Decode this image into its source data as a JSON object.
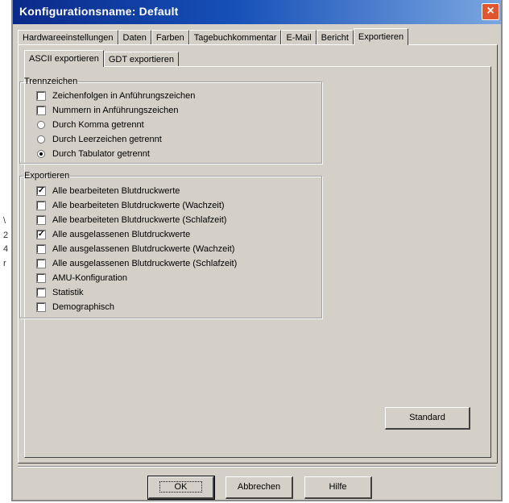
{
  "window": {
    "title": "Konfigurationsname: Default",
    "close_label": "×"
  },
  "outer_tabs": [
    {
      "label": "Hardwareeinstellungen",
      "active": false
    },
    {
      "label": "Daten",
      "active": false
    },
    {
      "label": "Farben",
      "active": false
    },
    {
      "label": "Tagebuchkommentar",
      "active": false
    },
    {
      "label": "E-Mail",
      "active": false
    },
    {
      "label": "Bericht",
      "active": false
    },
    {
      "label": "Exportieren",
      "active": true
    }
  ],
  "inner_tabs": [
    {
      "label": "ASCII exportieren",
      "active": true
    },
    {
      "label": "GDT exportieren",
      "active": false
    }
  ],
  "trennzeichen": {
    "legend": "Trennzeichen",
    "options": [
      {
        "type": "checkbox",
        "label": "Zeichenfolgen in Anführungszeichen",
        "checked": false
      },
      {
        "type": "checkbox",
        "label": "Nummern in Anführungszeichen",
        "checked": false
      },
      {
        "type": "radio",
        "label": "Durch Komma getrennt",
        "checked": false
      },
      {
        "type": "radio",
        "label": "Durch Leerzeichen getrennt",
        "checked": false
      },
      {
        "type": "radio",
        "label": "Durch Tabulator getrennt",
        "checked": true
      }
    ]
  },
  "exportieren": {
    "legend": "Exportieren",
    "options": [
      {
        "label": "Alle bearbeiteten Blutdruckwerte",
        "checked": true
      },
      {
        "label": "Alle bearbeiteten Blutdruckwerte (Wachzeit)",
        "checked": false
      },
      {
        "label": "Alle bearbeiteten Blutdruckwerte (Schlafzeit)",
        "checked": false
      },
      {
        "label": "Alle ausgelassenen Blutdruckwerte",
        "checked": true
      },
      {
        "label": "Alle ausgelassenen Blutdruckwerte (Wachzeit)",
        "checked": false
      },
      {
        "label": "Alle ausgelassenen Blutdruckwerte (Schlafzeit)",
        "checked": false
      },
      {
        "label": "AMU-Konfiguration",
        "checked": false
      },
      {
        "label": "Statistik",
        "checked": false
      },
      {
        "label": "Demographisch",
        "checked": false
      }
    ]
  },
  "buttons": {
    "standard": "Standard",
    "ok": "OK",
    "cancel": "Abbrechen",
    "help": "Hilfe"
  },
  "check_mark": "✓"
}
